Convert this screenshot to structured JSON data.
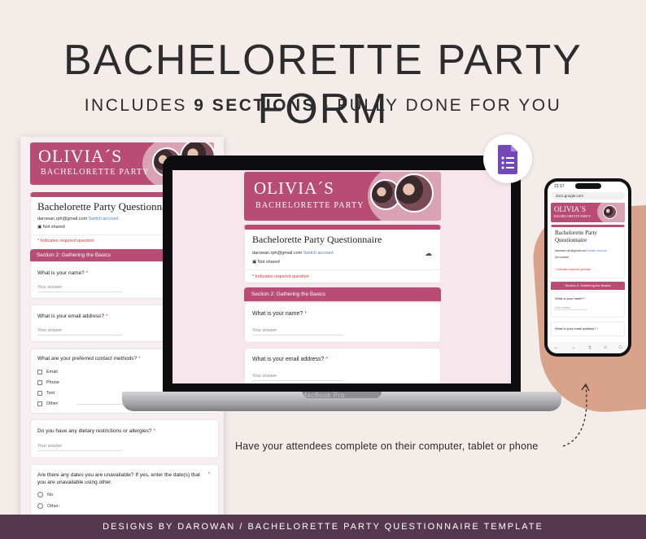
{
  "headline": "BACHELORETTE PARTY FORM",
  "subheadline": {
    "prefix": "INCLUDES ",
    "number": "9",
    "bold_word": " SECTIONS",
    "suffix": " - FULLY DONE FOR YOU"
  },
  "form": {
    "banner_name": "OLIVIA´S",
    "banner_subtitle": "BACHELORETTE PARTY",
    "title": "Bachelorette Party Questionnaire",
    "account_email": "darowan.rph@gmail.com",
    "switch_account": "Switch account",
    "not_shared": "Not shared",
    "required_note": "* Indicates required question",
    "section_title": "Section 2: Gathering the Basics",
    "answer_placeholder": "Your answer",
    "questions": [
      {
        "text": "What is your name?",
        "required": "*"
      },
      {
        "text": "What is your email address?",
        "required": "*"
      },
      {
        "text": "What are your preferred contact methods?",
        "required": "*"
      },
      {
        "text": "Do you have any dietary restrictions or allergies?",
        "required": "*"
      },
      {
        "text": "Are there any dates you are unavailable? If yes, enter the date(s) that you are unavailable using other.",
        "required": "*"
      }
    ],
    "contact_options": [
      "Email",
      "Phone",
      "Text",
      "Other:"
    ],
    "date_options": [
      "No",
      "Other:"
    ]
  },
  "laptop_label": "MacBook Pro",
  "phone": {
    "time": "21:17",
    "url": "docs.google.com",
    "title_line1": "Bachelorette Party",
    "title_line2": "Questionnaire"
  },
  "tagline": "Have your attendees complete on their computer, tablet or phone",
  "footer": "DESIGNS BY DAROWAN / BACHELORETTE PARTY QUESTIONNAIRE TEMPLATE",
  "colors": {
    "brand_pink": "#b84c72",
    "background": "#f3ece9",
    "footer": "#55384d",
    "forms_purple": "#7248b9"
  }
}
